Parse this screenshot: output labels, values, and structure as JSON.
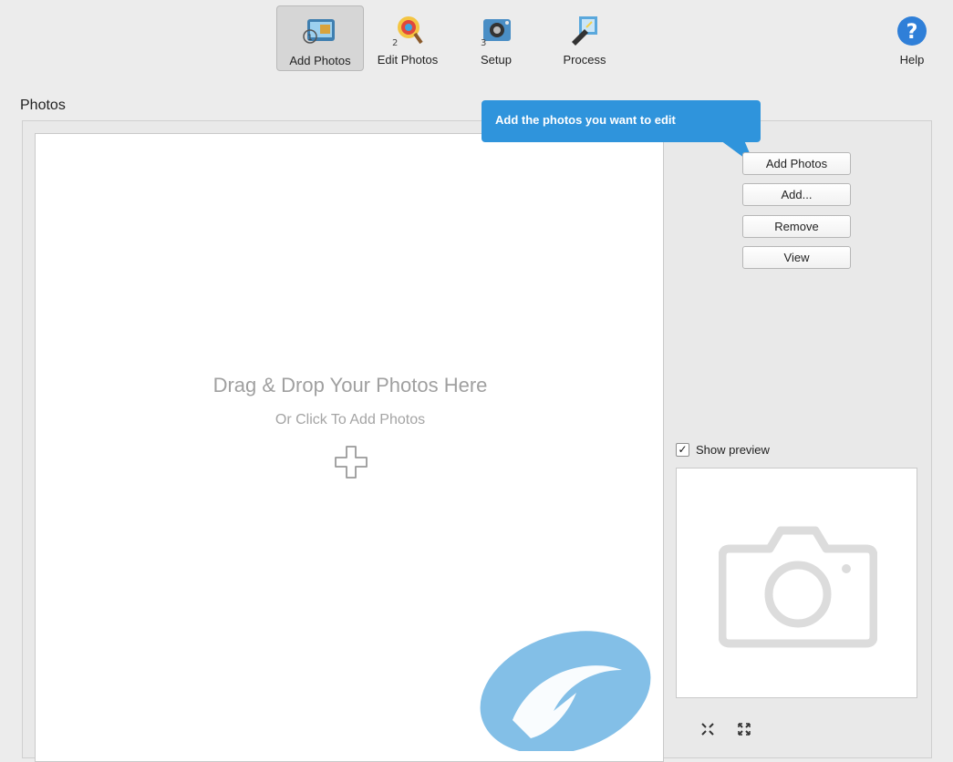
{
  "toolbar": {
    "buttons": [
      {
        "label": "Add Photos",
        "icon": "add-photos-icon",
        "active": true
      },
      {
        "label": "Edit Photos",
        "icon": "edit-photos-icon",
        "active": false
      },
      {
        "label": "Setup",
        "icon": "setup-icon",
        "active": false
      },
      {
        "label": "Process",
        "icon": "process-icon",
        "active": false
      }
    ],
    "help_label": "Help"
  },
  "section": {
    "title": "Photos"
  },
  "dropzone": {
    "title": "Drag & Drop Your Photos Here",
    "subtitle": "Or Click To Add Photos"
  },
  "tooltip": {
    "text": "Add the photos you want to edit"
  },
  "side_buttons": [
    "Add Photos",
    "Add...",
    "Remove",
    "View"
  ],
  "preview": {
    "checkbox_label": "Show preview",
    "checked": true,
    "checkmark": "✓"
  },
  "colors": {
    "accent": "#2f94dc",
    "drop_text": "#a0a0a0",
    "help_blue": "#2f7fd8"
  }
}
